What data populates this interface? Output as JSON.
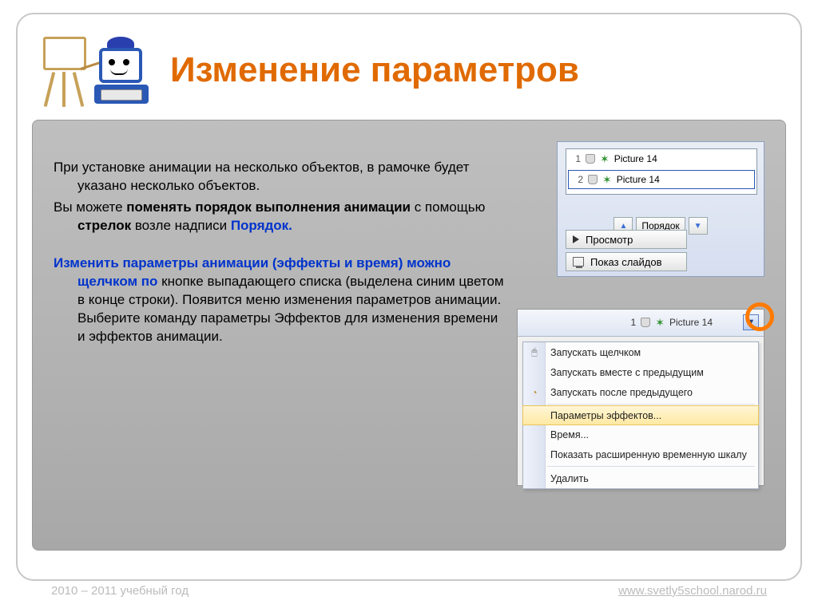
{
  "title": "Изменение параметров",
  "body": {
    "p1a": "При установке анимации на несколько объектов, в рамочке будет указано несколько объектов.",
    "p2_lead": "Вы можете ",
    "p2_b1": "поменять порядок выполнения анимации",
    "p2_mid": " с помощью ",
    "p2_b2": "стрелок",
    "p2_after": " возле надписи ",
    "p2_blue": "Порядок.",
    "p3_blue": "Изменить параметры анимации (эффекты и время) можно щелчком по",
    "p3_rest": " кнопке выпадающего списка (выделена синим цветом в конце строки). Появится меню изменения параметров анимации. Выберите команду параметры Эффектов для изменения времени и эффектов анимации."
  },
  "panel1": {
    "row1_num": "1",
    "row1_label": "Picture 14",
    "row2_num": "2",
    "row2_label": "Picture 14",
    "order_label": "Порядок",
    "preview": "Просмотр",
    "slideshow": "Показ слайдов"
  },
  "panel2": {
    "top_num": "1",
    "top_label": "Picture 14",
    "menu": {
      "m1": "Запускать щелчком",
      "m2": "Запускать вместе с предыдущим",
      "m3": "Запускать после предыдущего",
      "m4": "Параметры эффектов...",
      "m5": "Время...",
      "m6": "Показать расширенную временную шкалу",
      "m7": "Удалить"
    }
  },
  "footer": {
    "left": "2010 – 2011 учебный год",
    "right": "www.svetly5school.narod.ru"
  }
}
